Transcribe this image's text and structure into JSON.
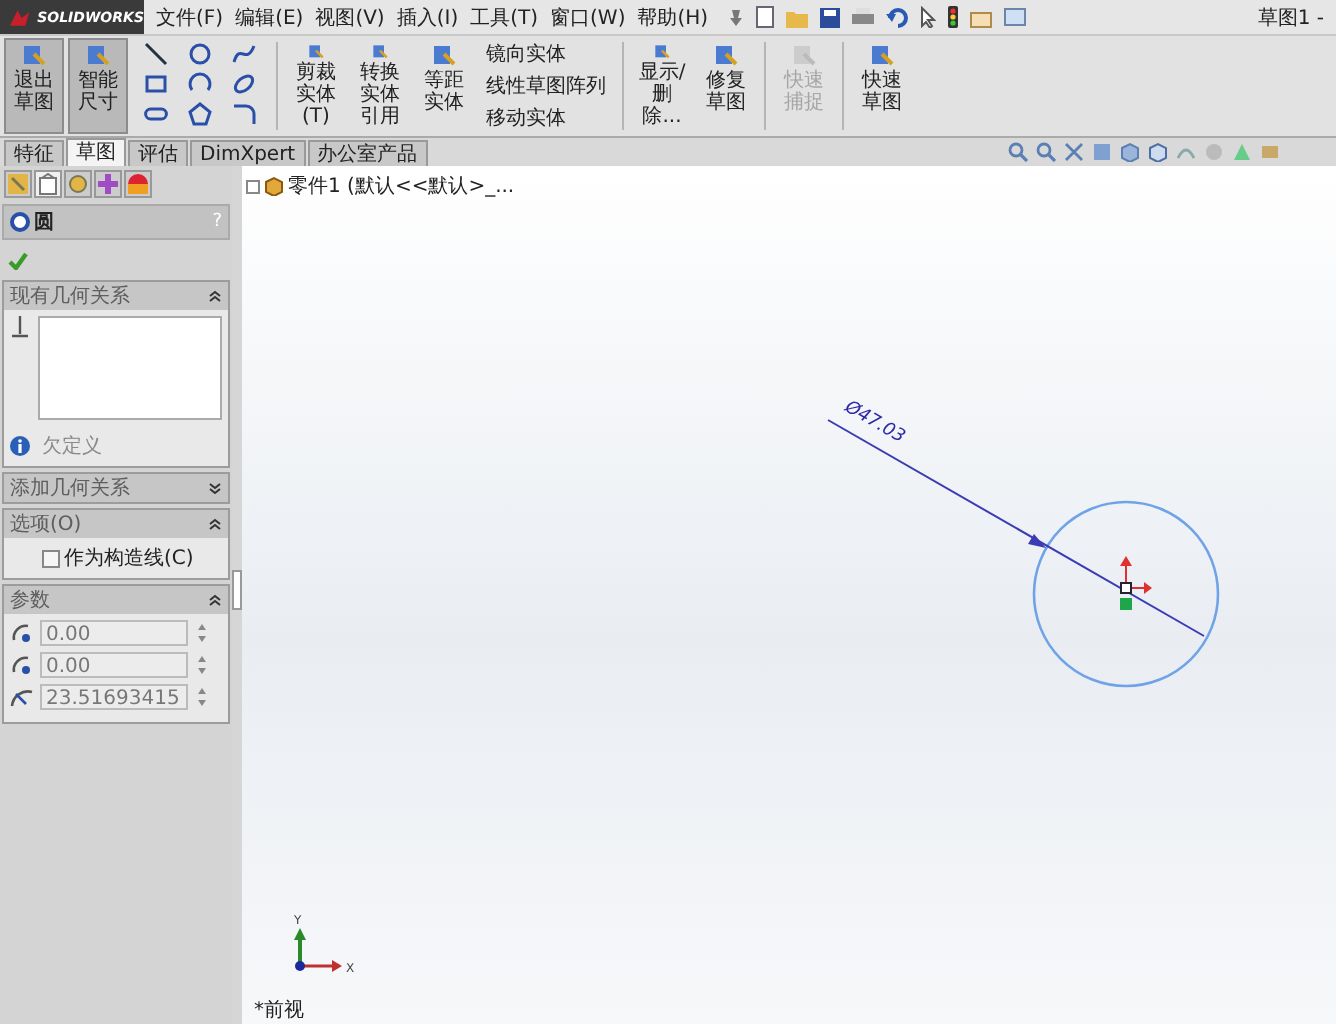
{
  "title_bar": {
    "logo": "SOLIDWORKS",
    "menus": [
      "文件(F)",
      "编辑(E)",
      "视图(V)",
      "插入(I)",
      "工具(T)",
      "窗口(W)",
      "帮助(H)"
    ],
    "document_title": "草图1 -"
  },
  "ribbon": [
    {
      "kind": "large",
      "label": "退出草图",
      "selected": true,
      "disabled": false
    },
    {
      "kind": "large",
      "label": "智能尺寸",
      "selected": true,
      "disabled": false
    },
    {
      "kind": "sketch_tools"
    },
    {
      "kind": "separator"
    },
    {
      "kind": "large",
      "label": "剪裁实体(T)",
      "selected": false,
      "disabled": false
    },
    {
      "kind": "large",
      "label": "转换实体引用",
      "selected": false,
      "disabled": false
    },
    {
      "kind": "large",
      "label": "等距实体",
      "selected": false,
      "disabled": false
    },
    {
      "kind": "list",
      "entries": [
        "镜向实体",
        "线性草图阵列",
        "移动实体"
      ]
    },
    {
      "kind": "separator"
    },
    {
      "kind": "large",
      "label": "显示/删除...",
      "selected": false,
      "disabled": false
    },
    {
      "kind": "large",
      "label": "修复草图",
      "selected": false,
      "disabled": false
    },
    {
      "kind": "separator"
    },
    {
      "kind": "large",
      "label": "快速捕捉",
      "selected": false,
      "disabled": true
    },
    {
      "kind": "separator"
    },
    {
      "kind": "large",
      "label": "快速草图",
      "selected": false,
      "disabled": false
    }
  ],
  "command_tabs": [
    {
      "label": "特征",
      "selected": false
    },
    {
      "label": "草图",
      "selected": true
    },
    {
      "label": "评估",
      "selected": false
    },
    {
      "label": "DimXpert",
      "selected": false
    },
    {
      "label": "办公室产品",
      "selected": false
    }
  ],
  "property_manager": {
    "title": "圆",
    "help": "?",
    "sections": [
      {
        "kind": "relations",
        "title": "现有几何关系",
        "expanded": true,
        "status": "欠定义"
      },
      {
        "title": "添加几何关系",
        "expanded": false
      },
      {
        "kind": "options",
        "title": "选项(O)",
        "expanded": true,
        "checkbox": {
          "label": "作为构造线(C)",
          "checked": false
        }
      },
      {
        "kind": "parameters",
        "title": "参数",
        "expanded": true,
        "fields": [
          {
            "kind": "x",
            "value": "0.00"
          },
          {
            "kind": "y",
            "value": "0.00"
          },
          {
            "kind": "radius",
            "value": "23.51693415"
          }
        ]
      }
    ]
  },
  "viewport": {
    "tree_item": "零件1 (默认<<默认>_...",
    "dimension": "Ø47.03",
    "axis_labels": [
      "Y",
      "X"
    ],
    "view_name": "*前视"
  }
}
